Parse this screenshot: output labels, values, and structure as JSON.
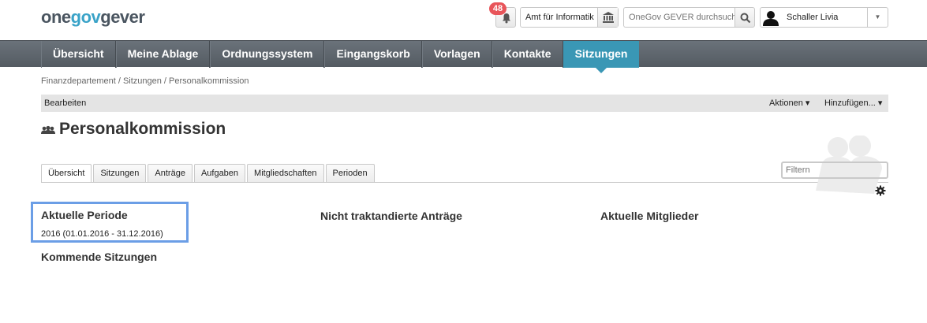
{
  "logo": {
    "part1": "one",
    "part2": "gov",
    "part3": "gever"
  },
  "header": {
    "notification_count": "48",
    "org_unit": "Amt für Informatik",
    "search_placeholder": "OneGov GEVER durchsuchen",
    "user_name": "Schaller Livia"
  },
  "nav": {
    "items": [
      {
        "label": "Übersicht"
      },
      {
        "label": "Meine Ablage"
      },
      {
        "label": "Ordnungssystem"
      },
      {
        "label": "Eingangskorb"
      },
      {
        "label": "Vorlagen"
      },
      {
        "label": "Kontakte"
      },
      {
        "label": "Sitzungen",
        "active": true
      }
    ]
  },
  "breadcrumb": "Finanzdepartement / Sitzungen / Personalkommission",
  "toolbar": {
    "edit": "Bearbeiten",
    "actions": "Aktionen ▾",
    "add": "Hinzufügen... ▾"
  },
  "page_title": "Personalkommission",
  "tabs": [
    {
      "label": "Übersicht",
      "active": true
    },
    {
      "label": "Sitzungen"
    },
    {
      "label": "Anträge"
    },
    {
      "label": "Aufgaben"
    },
    {
      "label": "Mitgliedschaften"
    },
    {
      "label": "Perioden"
    }
  ],
  "filter_placeholder": "Filtern",
  "sections": {
    "current_period_title": "Aktuelle Periode",
    "current_period_value": "2016 (01.01.2016 - 31.12.2016)",
    "upcoming_meetings_title": "Kommende Sitzungen",
    "unscheduled_proposals_title": "Nicht traktandierte Anträge",
    "current_members_title": "Aktuelle Mitglieder"
  },
  "colors": {
    "accent": "#3a97b5",
    "nav_bg": "#5f676e",
    "badge": "#e8555a",
    "highlight_border": "#6b9ee6"
  },
  "icons": [
    "bell-icon",
    "building-icon",
    "search-icon",
    "avatar",
    "chevron-down-icon",
    "group-icon",
    "gear-icon"
  ]
}
